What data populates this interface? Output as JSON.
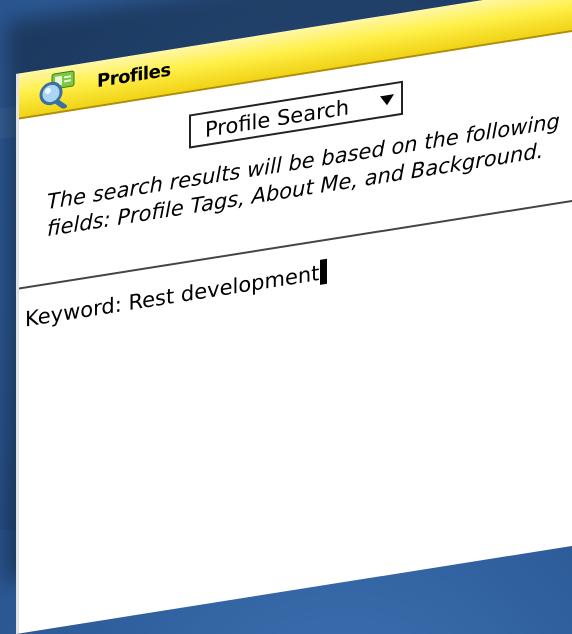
{
  "window": {
    "title": "Profiles",
    "icon": "profiles-search-icon"
  },
  "search_type": {
    "selected": "Profile Search"
  },
  "info_text": "The search results will be based on the following fields: Profile Tags, About Me, and Background.",
  "keyword": {
    "label": "Keyword:",
    "value": "Rest development"
  },
  "colors": {
    "titlebar": "#f5e32a",
    "background": "#2f5f9d"
  }
}
